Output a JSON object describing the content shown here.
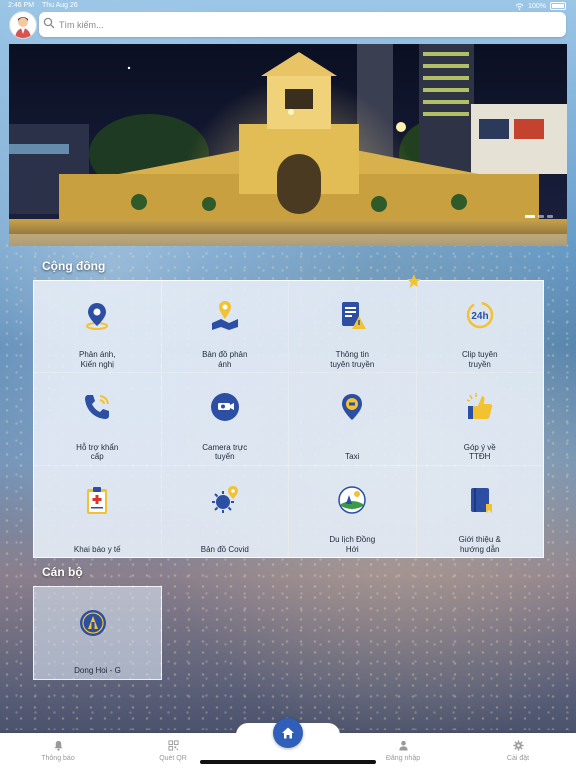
{
  "status": {
    "time": "2:46 PM",
    "day": "Thu Aug 26",
    "battery": "100%"
  },
  "search": {
    "placeholder": "Tìm kiếm..."
  },
  "sections": {
    "community": "Cộng đồng",
    "officials": "Cán bộ"
  },
  "community_items": [
    {
      "label": "Phản ánh,\nKiến nghị",
      "icon": "location-pin-icon"
    },
    {
      "label": "Bản đồ phản\nánh",
      "icon": "map-pin-icon"
    },
    {
      "label": "Thông tin\ntuyên truyền",
      "icon": "announcement-doc-icon"
    },
    {
      "label": "Clip tuyên\ntruyền",
      "icon": "24h-icon"
    },
    {
      "label": "Hỗ trợ khẩn\ncấp",
      "icon": "phone-icon"
    },
    {
      "label": "Camera trực\ntuyến",
      "icon": "camera-icon"
    },
    {
      "label": "Taxi",
      "icon": "taxi-pin-icon"
    },
    {
      "label": "Góp ý về\nTTĐH",
      "icon": "thumbs-up-icon"
    },
    {
      "label": "Khai báo y tế",
      "icon": "medical-clipboard-icon"
    },
    {
      "label": "Bản đồ Covid",
      "icon": "virus-icon"
    },
    {
      "label": "Du lịch Đồng\nHới",
      "icon": "travel-icon"
    },
    {
      "label": "Giới thiệu &\nhướng dẫn",
      "icon": "book-icon"
    }
  ],
  "officials_items": [
    {
      "label": "Dong Hoi - G",
      "icon": "official-badge-icon"
    }
  ],
  "tabbar": [
    {
      "label": "Thông báo",
      "icon": "bell-icon"
    },
    {
      "label": "Quét QR",
      "icon": "qr-icon"
    },
    {
      "label": "Đăng nhập",
      "icon": "user-icon"
    },
    {
      "label": "Cài đặt",
      "icon": "gear-icon"
    }
  ],
  "colors": {
    "accent": "#2f5fb8",
    "icon_blue": "#2c4fa3",
    "icon_yellow": "#f2c230"
  }
}
